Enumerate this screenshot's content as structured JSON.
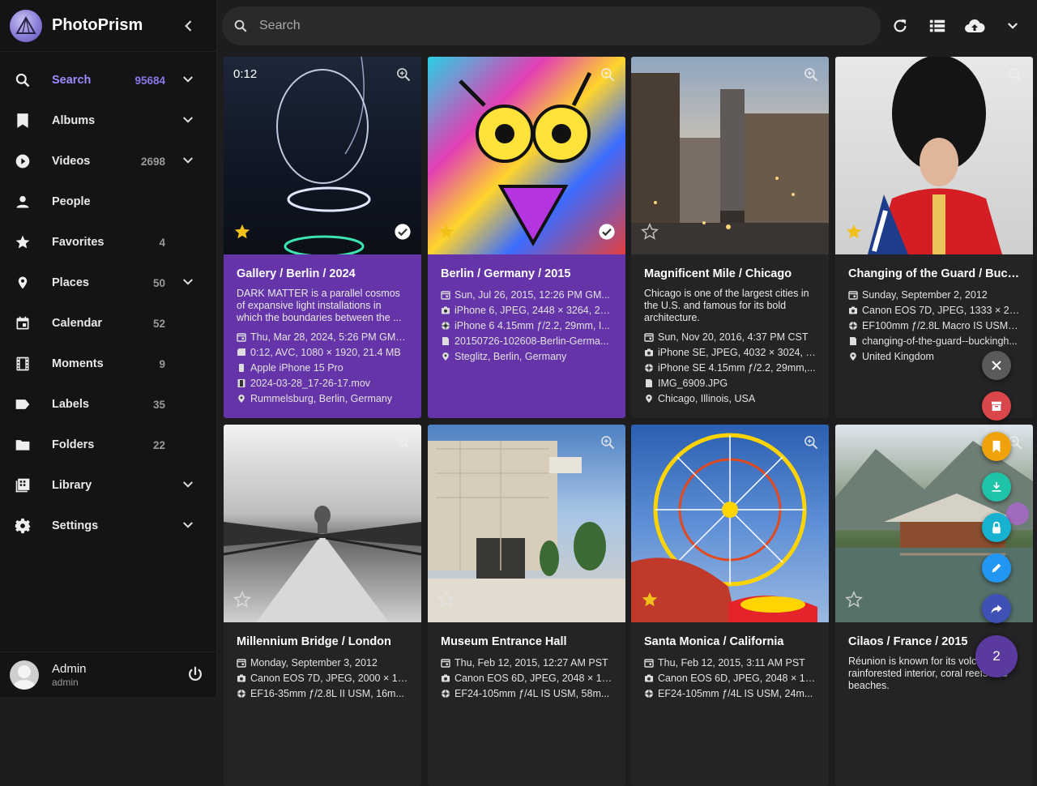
{
  "app": {
    "name": "PhotoPrism"
  },
  "search": {
    "placeholder": "Search"
  },
  "nav": [
    {
      "label": "Search",
      "count": "95684",
      "icon": "search-icon",
      "chevron": true,
      "active": true
    },
    {
      "label": "Albums",
      "count": "",
      "icon": "bookmark-icon",
      "chevron": true
    },
    {
      "label": "Videos",
      "count": "2698",
      "icon": "play-circle-icon",
      "chevron": true
    },
    {
      "label": "People",
      "count": "",
      "icon": "person-icon",
      "chevron": false
    },
    {
      "label": "Favorites",
      "count": "4",
      "icon": "star-icon",
      "chevron": false
    },
    {
      "label": "Places",
      "count": "50",
      "icon": "location-pin-icon",
      "chevron": true
    },
    {
      "label": "Calendar",
      "count": "52",
      "icon": "calendar-icon",
      "chevron": false
    },
    {
      "label": "Moments",
      "count": "9",
      "icon": "film-icon",
      "chevron": false
    },
    {
      "label": "Labels",
      "count": "35",
      "icon": "label-icon",
      "chevron": false
    },
    {
      "label": "Folders",
      "count": "22",
      "icon": "folder-icon",
      "chevron": false
    },
    {
      "label": "Library",
      "count": "",
      "icon": "library-icon",
      "chevron": true
    },
    {
      "label": "Settings",
      "count": "",
      "icon": "gear-icon",
      "chevron": true
    }
  ],
  "user": {
    "name": "Admin",
    "role": "admin"
  },
  "cards": [
    {
      "title": "Gallery / Berlin / 2024",
      "selected": true,
      "favorite": true,
      "duration": "0:12",
      "description": "DARK MATTER is a parallel cosmos of expansive light installations in which the boundaries between the ...",
      "rows": [
        {
          "icon": "calendar",
          "text": "Thu, Mar 28, 2024, 5:26 PM GMT..."
        },
        {
          "icon": "video",
          "text": "0:12, AVC, 1080 × 1920, 21.4 MB"
        },
        {
          "icon": "device",
          "text": "Apple iPhone 15 Pro"
        },
        {
          "icon": "film",
          "text": "2024-03-28_17-26-17.mov"
        },
        {
          "icon": "pin",
          "text": "Rummelsburg, Berlin, Germany"
        }
      ]
    },
    {
      "title": "Berlin / Germany / 2015",
      "selected": true,
      "favorite": true,
      "duration": "",
      "description": "",
      "rows": [
        {
          "icon": "calendar",
          "text": "Sun, Jul 26, 2015, 12:26 PM GM..."
        },
        {
          "icon": "camera",
          "text": "iPhone 6, JPEG, 2448 × 3264, 2.9..."
        },
        {
          "icon": "lens",
          "text": "iPhone 6 4.15mm ƒ/2.2, 29mm, I..."
        },
        {
          "icon": "file",
          "text": "20150726-102608-Berlin-Germa..."
        },
        {
          "icon": "pin",
          "text": "Steglitz, Berlin, Germany"
        }
      ]
    },
    {
      "title": "Magnificent Mile / Chicago",
      "selected": false,
      "favorite": false,
      "duration": "",
      "description": "Chicago is one of the largest cities in the U.S. and famous for its bold architecture.",
      "rows": [
        {
          "icon": "calendar",
          "text": "Sun, Nov 20, 2016, 4:37 PM CST"
        },
        {
          "icon": "camera",
          "text": "iPhone SE, JPEG, 4032 × 3024, 3..."
        },
        {
          "icon": "lens",
          "text": "iPhone SE 4.15mm ƒ/2.2, 29mm,..."
        },
        {
          "icon": "file",
          "text": "IMG_6909.JPG"
        },
        {
          "icon": "pin",
          "text": "Chicago, Illinois, USA"
        }
      ]
    },
    {
      "title": "Changing of the Guard / Bucki...",
      "selected": false,
      "favorite": true,
      "duration": "",
      "description": "",
      "rows": [
        {
          "icon": "calendar",
          "text": "Sunday, September 2, 2012"
        },
        {
          "icon": "camera",
          "text": "Canon EOS 7D, JPEG, 1333 × 20..."
        },
        {
          "icon": "lens",
          "text": "EF100mm ƒ/2.8L Macro IS USM, ..."
        },
        {
          "icon": "file",
          "text": "changing-of-the-guard--buckingh..."
        },
        {
          "icon": "pin",
          "text": "United Kingdom"
        }
      ]
    },
    {
      "title": "Millennium Bridge / London",
      "selected": false,
      "favorite": false,
      "duration": "",
      "description": "",
      "rows": [
        {
          "icon": "calendar",
          "text": "Monday, September 3, 2012"
        },
        {
          "icon": "camera",
          "text": "Canon EOS 7D, JPEG, 2000 × 13..."
        },
        {
          "icon": "lens",
          "text": "EF16-35mm ƒ/2.8L II USM, 16m..."
        }
      ]
    },
    {
      "title": "Museum Entrance Hall",
      "selected": false,
      "favorite": false,
      "duration": "",
      "description": "",
      "rows": [
        {
          "icon": "calendar",
          "text": "Thu, Feb 12, 2015, 12:27 AM PST"
        },
        {
          "icon": "camera",
          "text": "Canon EOS 6D, JPEG, 2048 × 13..."
        },
        {
          "icon": "lens",
          "text": "EF24-105mm ƒ/4L IS USM, 58m..."
        }
      ]
    },
    {
      "title": "Santa Monica / California",
      "selected": false,
      "favorite": true,
      "duration": "",
      "description": "",
      "rows": [
        {
          "icon": "calendar",
          "text": "Thu, Feb 12, 2015, 3:11 AM PST"
        },
        {
          "icon": "camera",
          "text": "Canon EOS 6D, JPEG, 2048 × 13..."
        },
        {
          "icon": "lens",
          "text": "EF24-105mm ƒ/4L IS USM, 24m..."
        }
      ]
    },
    {
      "title": "Cilaos / France / 2015",
      "selected": false,
      "favorite": false,
      "duration": "",
      "description": "Réunion is known for its volcanic, rainforested interior, coral reefs and beaches.",
      "rows": []
    }
  ],
  "selection": {
    "count": "2"
  },
  "colors": {
    "accent": "#6434a8",
    "star": "#f2c01a",
    "archive": "#d9474b",
    "album": "#f0a20a",
    "download": "#1fc3a8",
    "private": "#17b2d0",
    "edit": "#2196f3",
    "share": "#3f51b5"
  }
}
